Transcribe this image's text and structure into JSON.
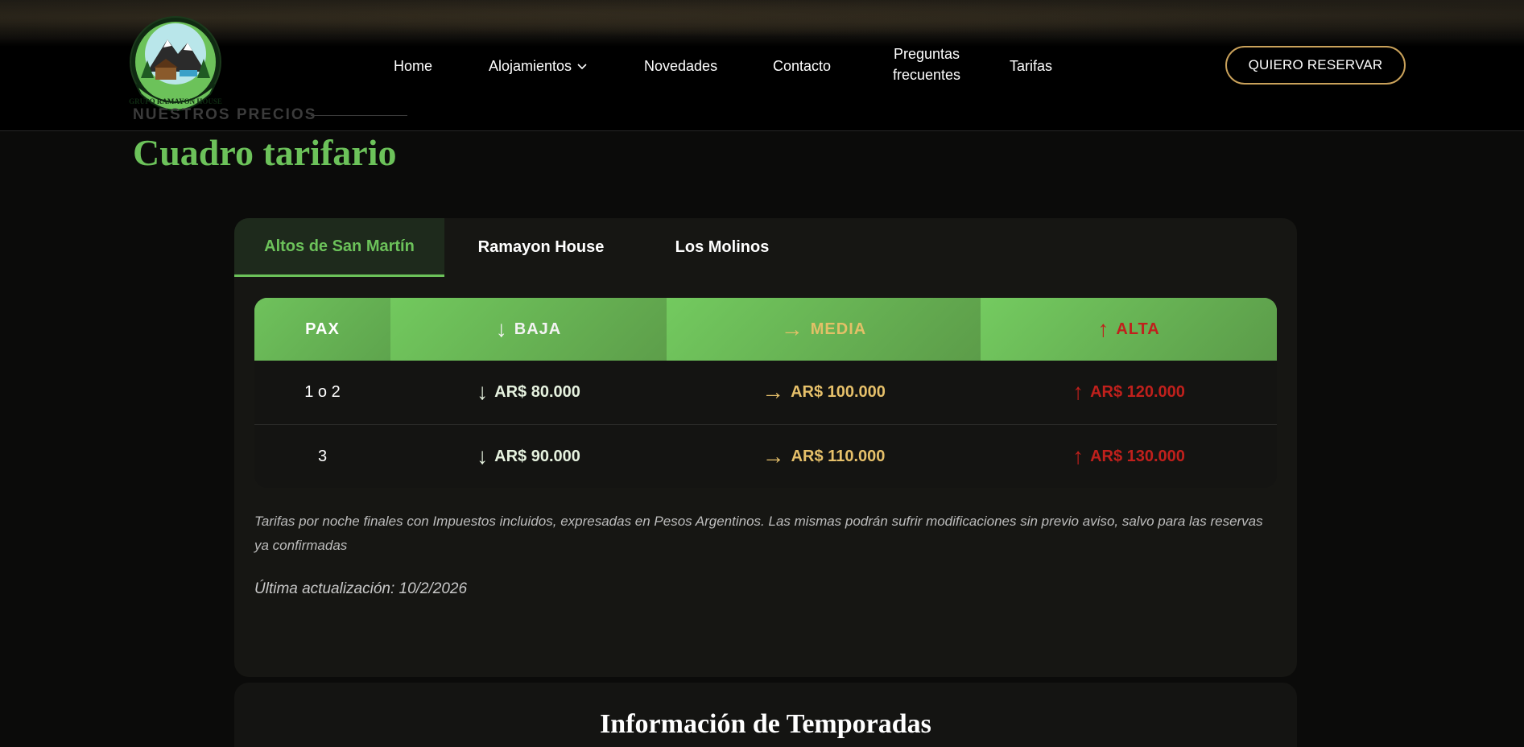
{
  "header": {
    "logo_text": "GRUPO RAMAYON HOUSE",
    "nav": {
      "home": "Home",
      "alojamientos": "Alojamientos",
      "novedades": "Novedades",
      "contacto": "Contacto",
      "preguntas_line1": "Preguntas",
      "preguntas_line2": "frecuentes",
      "tarifas": "Tarifas"
    },
    "reserve_button": "QUIERO RESERVAR"
  },
  "section": {
    "eyebrow": "NUESTROS PRECIOS",
    "title": "Cuadro tarifario"
  },
  "tabs": [
    {
      "label": "Altos de San Martín",
      "active": true
    },
    {
      "label": "Ramayon House",
      "active": false
    },
    {
      "label": "Los Molinos",
      "active": false
    }
  ],
  "table": {
    "headers": {
      "pax": "PAX",
      "baja": "BAJA",
      "media": "MEDIA",
      "alta": "ALTA"
    },
    "arrows": {
      "baja": "↓",
      "media": "→",
      "alta": "↑"
    },
    "rows": [
      {
        "pax": "1 o 2",
        "baja": "AR$ 80.000",
        "media": "AR$ 100.000",
        "alta": "AR$ 120.000"
      },
      {
        "pax": "3",
        "baja": "AR$ 90.000",
        "media": "AR$ 110.000",
        "alta": "AR$ 130.000"
      }
    ]
  },
  "note": "Tarifas por noche finales con Impuestos incluidos, expresadas en Pesos Argentinos. Las mismas podrán sufrir modificaciones sin previo aviso, salvo para las reservas ya confirmadas",
  "updated": "Última actualización: 10/2/2026",
  "seasons_title": "Información de Temporadas",
  "colors": {
    "accent_green": "#6cc25a",
    "media_gold": "#e6c06a",
    "alta_red": "#c0201c",
    "button_border": "#c9a15a"
  }
}
